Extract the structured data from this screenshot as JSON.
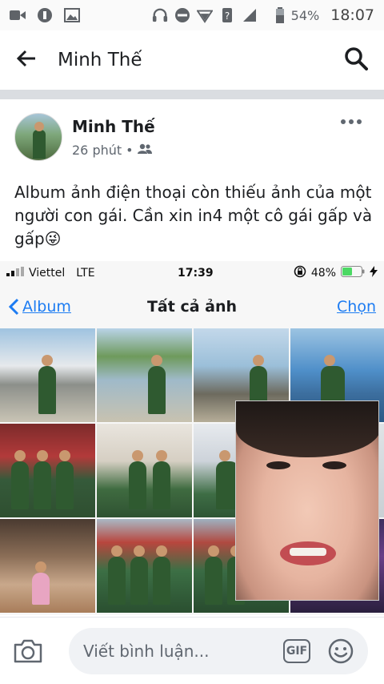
{
  "status_bar": {
    "icons": [
      "video-icon",
      "data-saver-icon",
      "image-icon",
      "headset-icon",
      "do-not-disturb-icon",
      "wifi-question-icon",
      "signal-3g-icon",
      "battery-icon"
    ],
    "network": "3G",
    "battery": "54%",
    "time": "18:07"
  },
  "header": {
    "title": "Minh Thế"
  },
  "post": {
    "author": "Minh Thế",
    "time": "26 phút",
    "separator": "•",
    "privacy": "friends",
    "text": "Album ảnh điện thoại còn thiếu ảnh của một người con gái. Cần xin in4 một cô gái gấp và gấp😜"
  },
  "embedded_screenshot": {
    "carrier": "Viettel",
    "network": "LTE",
    "time": "17:39",
    "battery": "48%",
    "back_label": "Album",
    "title": "Tất cả ảnh",
    "select_label": "Chọn"
  },
  "comment_bar": {
    "placeholder": "Viết bình luận...",
    "gif_label": "GIF"
  },
  "colors": {
    "ios_blue": "#1d7cf2",
    "divider": "#dadde1",
    "battery_green": "#4cd964"
  }
}
